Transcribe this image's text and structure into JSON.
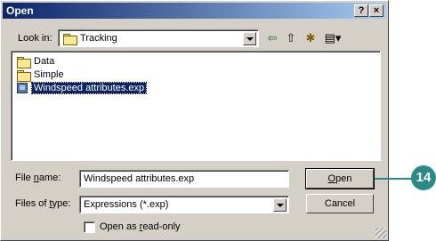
{
  "window": {
    "title": "Open",
    "help_glyph": "?",
    "close_glyph": "×"
  },
  "toolbar": {
    "look_in_label": "Look in:",
    "look_in_value": "Tracking",
    "back_glyph": "⇦",
    "up_glyph": "⇧",
    "new_folder_glyph": "✱",
    "views_glyph": "▤▾"
  },
  "files": [
    {
      "name": "Data",
      "icon": "folder-icon",
      "selected": false
    },
    {
      "name": "Simple",
      "icon": "folder-icon",
      "selected": false
    },
    {
      "name": "Windspeed attributes.exp",
      "icon": "expression-file-icon",
      "selected": true
    }
  ],
  "form": {
    "file_name_label": "File name:",
    "file_name_value": "Windspeed attributes.exp",
    "file_type_label": "Files of type:",
    "file_type_value": "Expressions (*.exp)",
    "read_only_label": "Open as read-only",
    "read_only_checked": false
  },
  "buttons": {
    "open": "Open",
    "cancel": "Cancel"
  },
  "callout": {
    "number": "14",
    "color": "#2a8a85"
  },
  "colors": {
    "selection": "#0a246a",
    "face": "#d4d0c8",
    "title_start": "#0a246a",
    "title_end": "#a6caf0"
  }
}
